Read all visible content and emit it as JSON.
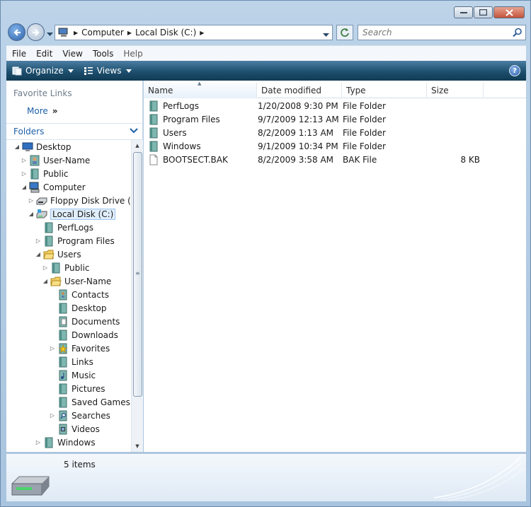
{
  "address": {
    "crumbs": [
      "Computer",
      "Local Disk (C:)"
    ]
  },
  "search": {
    "placeholder": "Search"
  },
  "menu": {
    "file": "File",
    "edit": "Edit",
    "view": "View",
    "tools": "Tools",
    "help": "Help"
  },
  "toolbar": {
    "organize": "Organize",
    "views": "Views",
    "help_glyph": "?"
  },
  "nav": {
    "favorite_links": "Favorite Links",
    "more": "More",
    "more_glyph": "»",
    "folders": "Folders",
    "tree": [
      {
        "label": "Desktop",
        "icon": "desktop-icon",
        "expander": "◢"
      },
      {
        "label": "User-Name",
        "icon": "user-folder-icon",
        "expander": "▷"
      },
      {
        "label": "Public",
        "icon": "folder-icon",
        "expander": "▷"
      },
      {
        "label": "Computer",
        "icon": "computer-icon",
        "expander": "◢"
      },
      {
        "label": "Floppy Disk Drive (A:)",
        "icon": "floppy-drive-icon",
        "expander": "▷"
      },
      {
        "label": "Local Disk (C:)",
        "icon": "local-disk-icon",
        "expander": "◢",
        "selected": true
      },
      {
        "label": "PerfLogs",
        "icon": "folder-icon",
        "expander": ""
      },
      {
        "label": "Program Files",
        "icon": "folder-icon",
        "expander": "▷"
      },
      {
        "label": "Users",
        "icon": "open-folder-icon",
        "expander": "◢"
      },
      {
        "label": "Public",
        "icon": "folder-icon",
        "expander": "▷"
      },
      {
        "label": "User-Name",
        "icon": "open-folder-icon",
        "expander": "◢"
      },
      {
        "label": "Contacts",
        "icon": "contacts-icon",
        "expander": ""
      },
      {
        "label": "Desktop",
        "icon": "folder-icon",
        "expander": ""
      },
      {
        "label": "Documents",
        "icon": "documents-icon",
        "expander": ""
      },
      {
        "label": "Downloads",
        "icon": "folder-icon",
        "expander": ""
      },
      {
        "label": "Favorites",
        "icon": "favorites-icon",
        "expander": "▷"
      },
      {
        "label": "Links",
        "icon": "folder-icon",
        "expander": ""
      },
      {
        "label": "Music",
        "icon": "music-icon",
        "expander": ""
      },
      {
        "label": "Pictures",
        "icon": "folder-icon",
        "expander": ""
      },
      {
        "label": "Saved Games",
        "icon": "folder-icon",
        "expander": ""
      },
      {
        "label": "Searches",
        "icon": "searches-icon",
        "expander": "▷"
      },
      {
        "label": "Videos",
        "icon": "videos-icon",
        "expander": ""
      },
      {
        "label": "Windows",
        "icon": "folder-icon",
        "expander": "▷"
      }
    ]
  },
  "columns": {
    "name": "Name",
    "date": "Date modified",
    "type": "Type",
    "size": "Size"
  },
  "files": [
    {
      "name": "PerfLogs",
      "date": "1/20/2008 9:30 PM",
      "type": "File Folder",
      "size": "",
      "icon": "folder-icon"
    },
    {
      "name": "Program Files",
      "date": "9/7/2009 12:13 AM",
      "type": "File Folder",
      "size": "",
      "icon": "folder-icon"
    },
    {
      "name": "Users",
      "date": "8/2/2009 1:13 AM",
      "type": "File Folder",
      "size": "",
      "icon": "folder-icon"
    },
    {
      "name": "Windows",
      "date": "9/1/2009 10:34 PM",
      "type": "File Folder",
      "size": "",
      "icon": "folder-icon"
    },
    {
      "name": "BOOTSECT.BAK",
      "date": "8/2/2009 3:58 AM",
      "type": "BAK File",
      "size": "8 KB",
      "icon": "file-icon"
    }
  ],
  "status": {
    "item_count": "5 items"
  },
  "colors": {
    "toolbar": "#1d4f6e",
    "link": "#1d5fa8",
    "selection": "#e0eefb"
  }
}
